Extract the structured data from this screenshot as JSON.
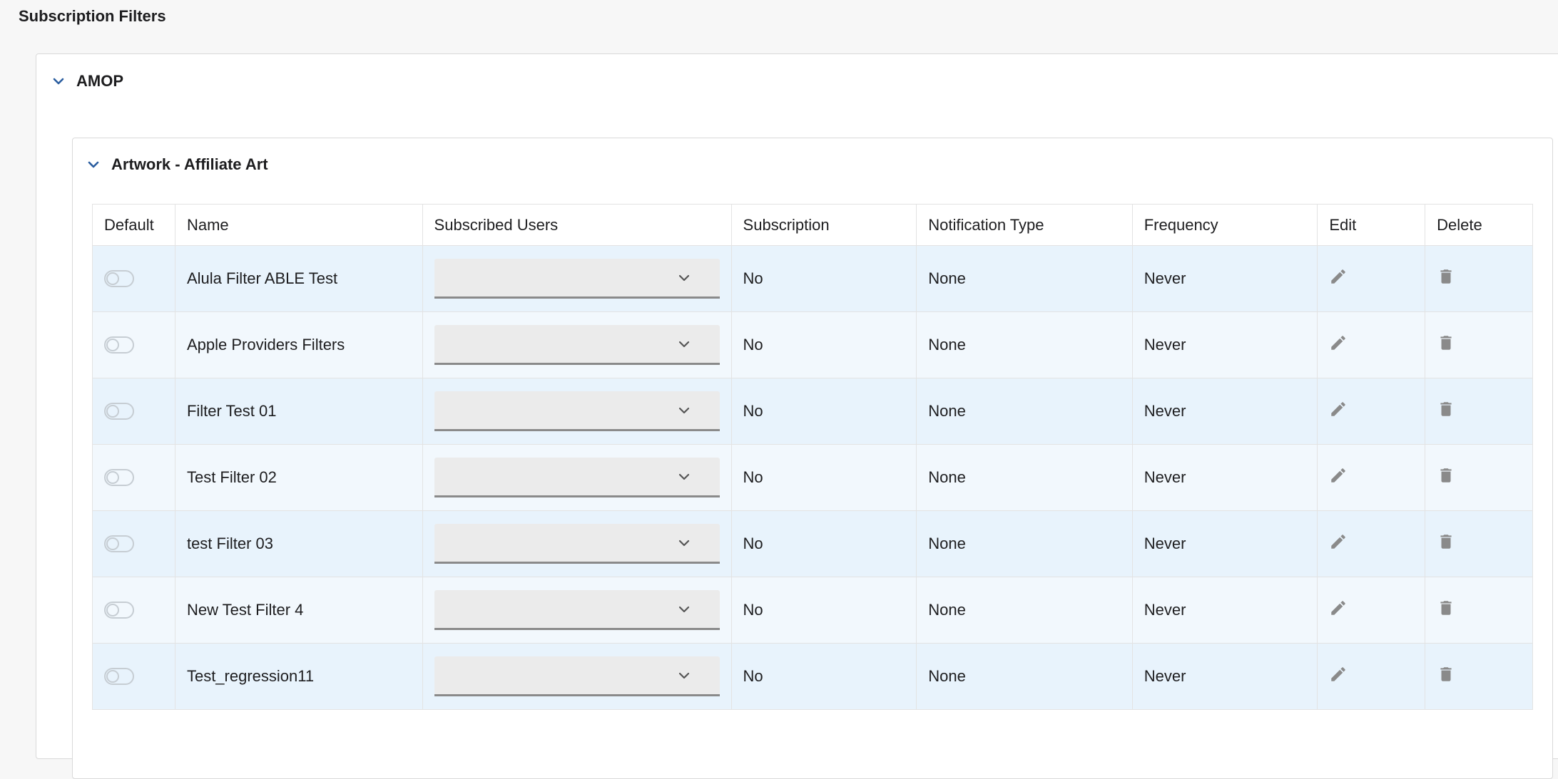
{
  "page_title": "Subscription Filters",
  "group": {
    "title": "AMOP"
  },
  "subgroup": {
    "title": "Artwork - Affiliate Art"
  },
  "columns": {
    "default": "Default",
    "name": "Name",
    "subscribed_users": "Subscribed Users",
    "subscription": "Subscription",
    "notification_type": "Notification Type",
    "frequency": "Frequency",
    "edit": "Edit",
    "delete": "Delete"
  },
  "rows": [
    {
      "default": false,
      "name": "Alula Filter ABLE Test",
      "subscribed_users": "",
      "subscription": "No",
      "notification_type": "None",
      "frequency": "Never"
    },
    {
      "default": false,
      "name": "Apple Providers Filters",
      "subscribed_users": "",
      "subscription": "No",
      "notification_type": "None",
      "frequency": "Never"
    },
    {
      "default": false,
      "name": "Filter Test 01",
      "subscribed_users": "",
      "subscription": "No",
      "notification_type": "None",
      "frequency": "Never"
    },
    {
      "default": false,
      "name": "Test Filter 02",
      "subscribed_users": "",
      "subscription": "No",
      "notification_type": "None",
      "frequency": "Never"
    },
    {
      "default": false,
      "name": "test Filter 03",
      "subscribed_users": "",
      "subscription": "No",
      "notification_type": "None",
      "frequency": "Never"
    },
    {
      "default": false,
      "name": "New Test Filter 4",
      "subscribed_users": "",
      "subscription": "No",
      "notification_type": "None",
      "frequency": "Never"
    },
    {
      "default": false,
      "name": "Test_regression11",
      "subscribed_users": "",
      "subscription": "No",
      "notification_type": "None",
      "frequency": "Never"
    }
  ],
  "icons": {
    "section_toggle": "chevron-down-icon",
    "select": "chevron-down-icon",
    "edit": "pencil-icon",
    "delete": "trash-icon"
  },
  "colors": {
    "accent": "#2a5d9f",
    "row_odd": "#e8f3fc",
    "row_even": "#f2f8fd",
    "icon_gray": "#8a8a8a"
  }
}
